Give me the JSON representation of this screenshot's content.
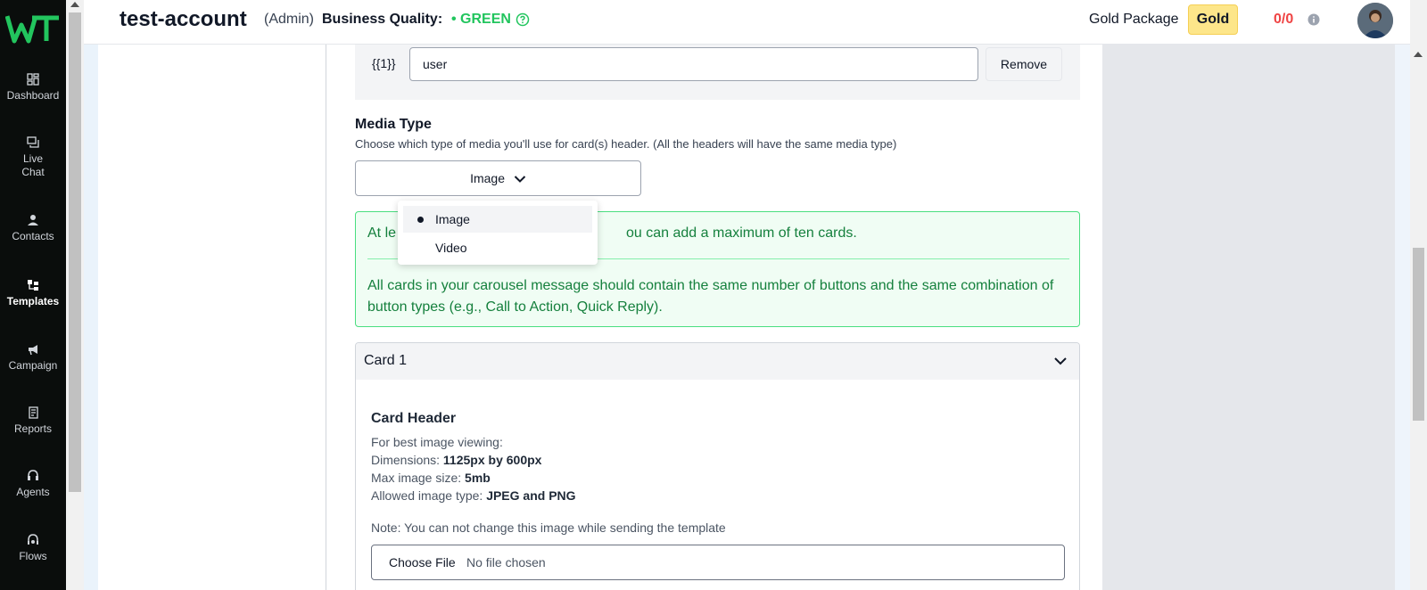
{
  "sidebar": {
    "logo": "WT",
    "items": [
      {
        "label": "Dashboard",
        "icon": "dashboard-icon"
      },
      {
        "label": "Live Chat",
        "icon": "chat-icon"
      },
      {
        "label": "Contacts",
        "icon": "contacts-icon"
      },
      {
        "label": "Templates",
        "icon": "templates-icon",
        "active": true
      },
      {
        "label": "Campaign",
        "icon": "megaphone-icon"
      },
      {
        "label": "Reports",
        "icon": "reports-icon"
      },
      {
        "label": "Agents",
        "icon": "headset-icon"
      },
      {
        "label": "Flows",
        "icon": "flows-icon"
      }
    ]
  },
  "header": {
    "account_name": "test-account",
    "role": "(Admin)",
    "business_quality_label": "Business Quality:",
    "business_quality_value": "• GREEN",
    "package_label": "Gold Package",
    "package_badge": "Gold",
    "count": "0/0"
  },
  "variable": {
    "label": "{{1}}",
    "value": "user",
    "remove_label": "Remove"
  },
  "media_type": {
    "title": "Media Type",
    "description": "Choose which type of media you'll use for card(s) header. (All the headers will have the same media type)",
    "selected": "Image",
    "options": [
      "Image",
      "Video"
    ]
  },
  "alert": {
    "line1": "At least two cards are required. You can add a maximum of ten cards.",
    "line1_visible_prefix": "At le",
    "line1_visible_suffix": "ou can add a maximum of ten cards.",
    "line2": "All cards in your carousel message should contain the same number of buttons and the same combination of button types (e.g., Call to Action, Quick Reply)."
  },
  "card": {
    "title": "Card 1",
    "header_title": "Card Header",
    "best_viewing": "For best image viewing:",
    "dimensions_label": "Dimensions:",
    "dimensions_value": "1125px by 600px",
    "max_size_label": "Max image size:",
    "max_size_value": "5mb",
    "allowed_label": "Allowed image type:",
    "allowed_value": "JPEG and PNG",
    "note": "Note: You can not change this image while sending the template",
    "file_button": "Choose File",
    "file_status": "No file chosen"
  },
  "colors": {
    "sidebar_bg": "#0a0d0c",
    "quality_green": "#22c55e",
    "gold_badge": "#fde68a",
    "count_red": "#ef4444",
    "alert_bg": "#f0fdf4",
    "alert_text": "#15803d"
  }
}
